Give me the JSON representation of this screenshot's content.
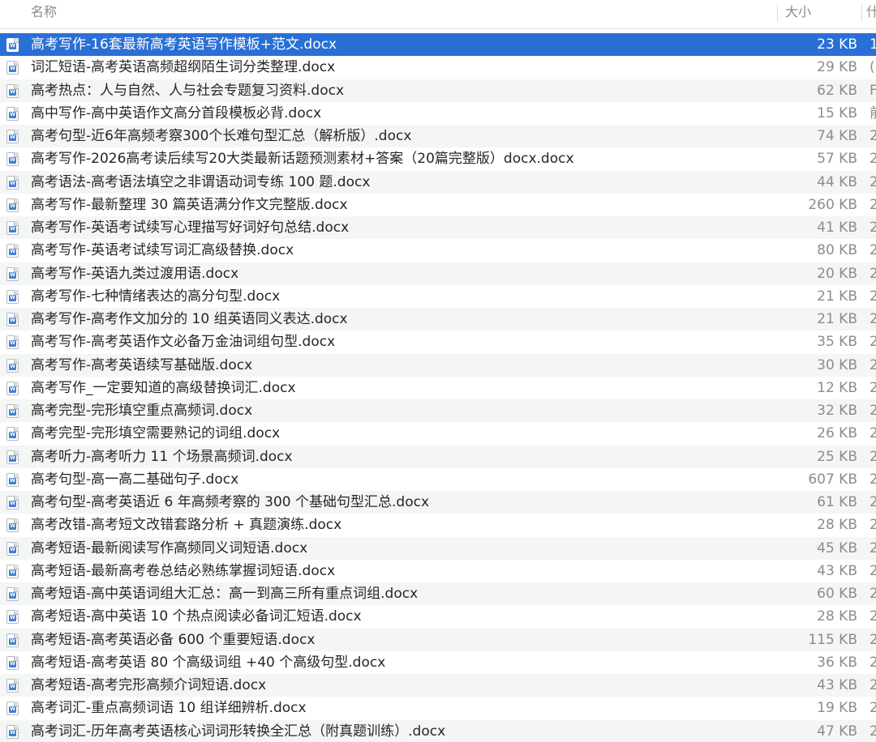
{
  "header": {
    "name_label": "名称",
    "size_label": "大小",
    "kind_label": "什"
  },
  "colors": {
    "selection": "#2a6fd6",
    "row_alt": "#f4f5f5",
    "text": "#262626",
    "secondary_text": "#8c8c8c",
    "word_icon": "#3f7fd3"
  },
  "file_icon": "word-document-icon",
  "file_icon_glyph": "W",
  "files": [
    {
      "name": "高考写作-16套最新高考英语写作模板+范文.docx",
      "size": "23 KB",
      "kind": "1",
      "selected": true
    },
    {
      "name": "词汇短语-高考英语高频超纲陌生词分类整理.docx",
      "size": "29 KB",
      "kind": "("
    },
    {
      "name": "高考热点：人与自然、人与社会专题复习资料.docx",
      "size": "62 KB",
      "kind": "F"
    },
    {
      "name": "高中写作-高中英语作文高分首段模板必背.docx",
      "size": "15 KB",
      "kind": "前"
    },
    {
      "name": "高考句型-近6年高频考察300个长难句型汇总（解析版）.docx",
      "size": "74 KB",
      "kind": "2"
    },
    {
      "name": "高考写作-2026高考读后续写20大类最新话题预测素材+答案（20篇完整版）docx.docx",
      "size": "57 KB",
      "kind": "2"
    },
    {
      "name": "高考语法-高考语法填空之非谓语动词专练 100 题.docx",
      "size": "44 KB",
      "kind": "2"
    },
    {
      "name": "高考写作-最新整理 30 篇英语满分作文完整版.docx",
      "size": "260 KB",
      "kind": "2"
    },
    {
      "name": "高考写作-英语考试续写心理描写好词好句总结.docx",
      "size": "41 KB",
      "kind": "2"
    },
    {
      "name": "高考写作-英语考试续写词汇高级替换.docx",
      "size": "80 KB",
      "kind": "2"
    },
    {
      "name": "高考写作-英语九类过渡用语.docx",
      "size": "20 KB",
      "kind": "2"
    },
    {
      "name": "高考写作-七种情绪表达的高分句型.docx",
      "size": "21 KB",
      "kind": "2"
    },
    {
      "name": "高考写作-高考作文加分的 10 组英语同义表达.docx",
      "size": "21 KB",
      "kind": "2"
    },
    {
      "name": "高考写作-高考英语作文必备万金油词组句型.docx",
      "size": "35 KB",
      "kind": "2"
    },
    {
      "name": "高考写作-高考英语续写基础版.docx",
      "size": "30 KB",
      "kind": "2"
    },
    {
      "name": "高考写作_一定要知道的高级替换词汇.docx",
      "size": "12 KB",
      "kind": "2"
    },
    {
      "name": "高考完型-完形填空重点高频词.docx",
      "size": "32 KB",
      "kind": "2"
    },
    {
      "name": "高考完型-完形填空需要熟记的词组.docx",
      "size": "26 KB",
      "kind": "2"
    },
    {
      "name": "高考听力-高考听力 11 个场景高频词.docx",
      "size": "25 KB",
      "kind": "2"
    },
    {
      "name": "高考句型-高一高二基础句子.docx",
      "size": "607 KB",
      "kind": "2"
    },
    {
      "name": "高考句型-高考英语近 6 年高频考察的 300 个基础句型汇总.docx",
      "size": "61 KB",
      "kind": "2"
    },
    {
      "name": "高考改错-高考短文改错套路分析 + 真题演练.docx",
      "size": "28 KB",
      "kind": "2"
    },
    {
      "name": "高考短语-最新阅读写作高频同义词短语.docx",
      "size": "45 KB",
      "kind": "2"
    },
    {
      "name": "高考短语-最新高考卷总结必熟练掌握词短语.docx",
      "size": "43 KB",
      "kind": "2"
    },
    {
      "name": "高考短语-高中英语词组大汇总：高一到高三所有重点词组.docx",
      "size": "60 KB",
      "kind": "2"
    },
    {
      "name": "高考短语-高中英语 10 个热点阅读必备词汇短语.docx",
      "size": "28 KB",
      "kind": "2"
    },
    {
      "name": "高考短语-高考英语必备 600 个重要短语.docx",
      "size": "115 KB",
      "kind": "2"
    },
    {
      "name": "高考短语-高考英语 80 个高级词组 +40 个高级句型.docx",
      "size": "36 KB",
      "kind": "2"
    },
    {
      "name": "高考短语-高考完形高频介词短语.docx",
      "size": "43 KB",
      "kind": "2"
    },
    {
      "name": "高考词汇-重点高频词语 10 组详细辨析.docx",
      "size": "19 KB",
      "kind": "2"
    },
    {
      "name": "高考词汇-历年高考英语核心词词形转换全汇总（附真题训练）.docx",
      "size": "47 KB",
      "kind": "2"
    }
  ]
}
